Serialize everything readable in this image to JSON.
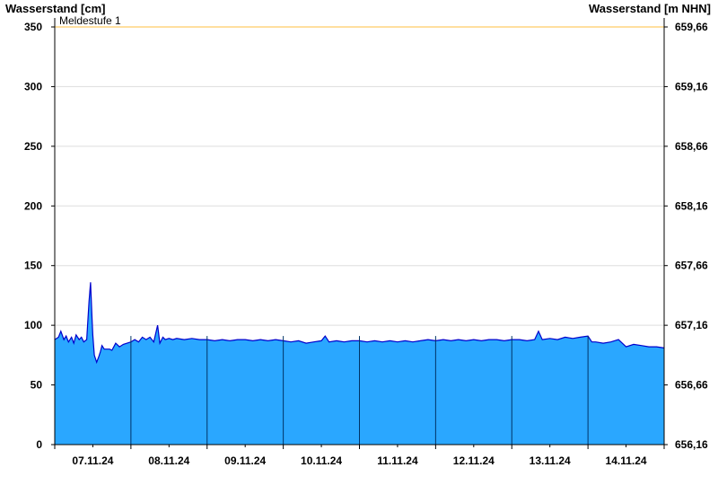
{
  "chart_data": {
    "type": "area",
    "y_axis_title_left": "Wasserstand [cm]",
    "y_axis_title_right": "Wasserstand [m NHN]",
    "ylim": [
      0,
      350
    ],
    "y_ticks_left": [
      "0",
      "50",
      "100",
      "150",
      "200",
      "250",
      "300",
      "350"
    ],
    "y_ticks_right": [
      "656,16",
      "656,66",
      "657,16",
      "657,66",
      "658,16",
      "658,66",
      "659,16",
      "659,66"
    ],
    "x_tick_labels": [
      "07.11.24",
      "08.11.24",
      "09.11.24",
      "10.11.24",
      "11.11.24",
      "12.11.24",
      "13.11.24",
      "14.11.24"
    ],
    "x_range_days": [
      0,
      8
    ],
    "threshold": {
      "label": "Meldestufe 1",
      "value": 350,
      "color": "#ffcc66"
    },
    "grid": true,
    "colors": {
      "fill": "#2aa7ff",
      "line": "#0000cc",
      "grid": "#dddddd",
      "day_divider": "#003366"
    },
    "series": [
      {
        "x": [
          0,
          0.05,
          0.08,
          0.12,
          0.15,
          0.18,
          0.22,
          0.25,
          0.28,
          0.32,
          0.35,
          0.38,
          0.42,
          0.45,
          0.47,
          0.49,
          0.5,
          0.52,
          0.55,
          0.58,
          0.6,
          0.62,
          0.65,
          0.68,
          0.72,
          0.75,
          0.8,
          0.85,
          0.9,
          0.95,
          1.0,
          1.05,
          1.1,
          1.15,
          1.2,
          1.25,
          1.3,
          1.35,
          1.38,
          1.42,
          1.45,
          1.5,
          1.55,
          1.6,
          1.7,
          1.8,
          1.9,
          2.0,
          2.1,
          2.2,
          2.3,
          2.4,
          2.5,
          2.6,
          2.7,
          2.8,
          2.9,
          3.0,
          3.1,
          3.2,
          3.3,
          3.4,
          3.5,
          3.55,
          3.6,
          3.7,
          3.8,
          3.9,
          4.0,
          4.1,
          4.2,
          4.3,
          4.4,
          4.5,
          4.6,
          4.7,
          4.8,
          4.9,
          5.0,
          5.1,
          5.2,
          5.3,
          5.4,
          5.5,
          5.6,
          5.7,
          5.8,
          5.9,
          6.0,
          6.1,
          6.2,
          6.3,
          6.35,
          6.4,
          6.5,
          6.6,
          6.7,
          6.8,
          6.9,
          7.0,
          7.05,
          7.1,
          7.2,
          7.3,
          7.4,
          7.5,
          7.6,
          7.7,
          7.8,
          7.9,
          8.0
        ],
        "values": [
          88,
          90,
          95,
          88,
          91,
          86,
          90,
          85,
          92,
          88,
          90,
          86,
          88,
          120,
          136,
          105,
          92,
          75,
          69,
          74,
          78,
          83,
          80,
          80,
          80,
          79,
          85,
          82,
          84,
          85,
          86,
          88,
          86,
          90,
          88,
          90,
          86,
          100,
          85,
          90,
          88,
          89,
          88,
          89,
          88,
          89,
          88,
          88,
          87,
          88,
          87,
          88,
          88,
          87,
          88,
          87,
          88,
          87,
          86,
          87,
          85,
          86,
          87,
          91,
          86,
          87,
          86,
          87,
          87,
          86,
          87,
          86,
          87,
          86,
          87,
          86,
          87,
          88,
          87,
          88,
          87,
          88,
          87,
          88,
          87,
          88,
          88,
          87,
          88,
          88,
          87,
          88,
          95,
          88,
          89,
          88,
          90,
          89,
          90,
          91,
          86,
          86,
          85,
          86,
          88,
          82,
          84,
          83,
          82,
          82,
          81
        ]
      }
    ]
  }
}
